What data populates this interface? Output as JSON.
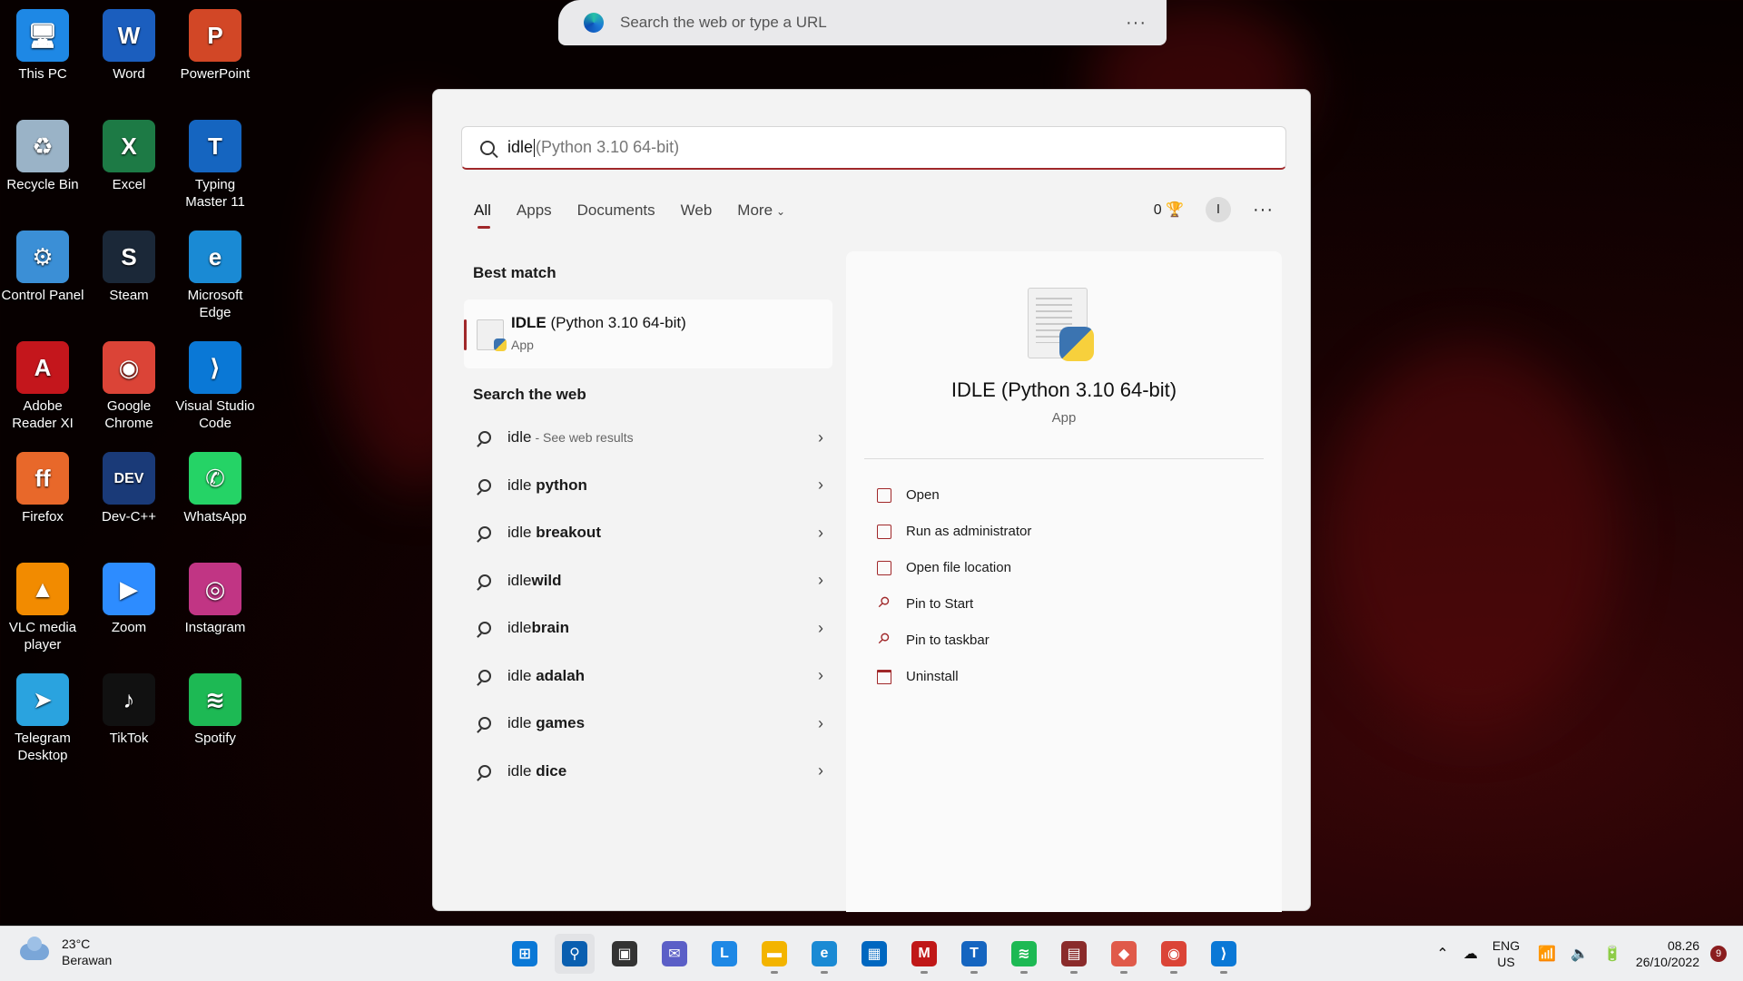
{
  "desktop": {
    "icons": [
      {
        "label": "This PC",
        "glyph": "🖥",
        "color": "#1e88e5"
      },
      {
        "label": "Word",
        "glyph": "W",
        "color": "#1b5ebe"
      },
      {
        "label": "PowerPoint",
        "glyph": "P",
        "color": "#d24726"
      },
      {
        "label": "Recycle Bin",
        "glyph": "♻",
        "color": "#9ab3c7"
      },
      {
        "label": "Excel",
        "glyph": "X",
        "color": "#1d7a45"
      },
      {
        "label": "Typing Master 11",
        "glyph": "T",
        "color": "#1565c0"
      },
      {
        "label": "Control Panel",
        "glyph": "⚙",
        "color": "#3b8fd6"
      },
      {
        "label": "Steam",
        "glyph": "S",
        "color": "#1b2838"
      },
      {
        "label": "Microsoft Edge",
        "glyph": "e",
        "color": "#1a8ad4"
      },
      {
        "label": "Adobe Reader XI",
        "glyph": "A",
        "color": "#c4161c"
      },
      {
        "label": "Google Chrome",
        "glyph": "◉",
        "color": "#db4437"
      },
      {
        "label": "Visual Studio Code",
        "glyph": "⟩",
        "color": "#0a78d6"
      },
      {
        "label": "Firefox",
        "glyph": "ff",
        "color": "#e8682a"
      },
      {
        "label": "Dev-C++",
        "glyph": "DEV",
        "color": "#1a3a78"
      },
      {
        "label": "WhatsApp",
        "glyph": "✆",
        "color": "#25d366"
      },
      {
        "label": "VLC media player",
        "glyph": "▲",
        "color": "#f28b00"
      },
      {
        "label": "Zoom",
        "glyph": "▶",
        "color": "#2d8cff"
      },
      {
        "label": "Instagram",
        "glyph": "◎",
        "color": "#c13584"
      },
      {
        "label": "Telegram Desktop",
        "glyph": "➤",
        "color": "#2aa3df"
      },
      {
        "label": "TikTok",
        "glyph": "♪",
        "color": "#111111"
      },
      {
        "label": "Spotify",
        "glyph": "≋",
        "color": "#1db954"
      }
    ]
  },
  "browser": {
    "placeholder": "Search the web or type a URL",
    "menu": "···"
  },
  "search": {
    "typed": "idle",
    "hint": "(Python 3.10 64-bit)",
    "tabs": [
      "All",
      "Apps",
      "Documents",
      "Web",
      "More"
    ],
    "points": "0",
    "avatar": "I",
    "menu": "···",
    "best_match_title": "Best match",
    "best_match": {
      "name_bold": "IDLE",
      "name_rest": " (Python 3.10 64-bit)",
      "type": "App"
    },
    "web_title": "Search the web",
    "web_results": [
      {
        "q": "idle",
        "bold": "",
        "extra": "- See web results"
      },
      {
        "q": "idle ",
        "bold": "python",
        "extra": ""
      },
      {
        "q": "idle ",
        "bold": "breakout",
        "extra": ""
      },
      {
        "q": "idle",
        "bold": "wild",
        "extra": ""
      },
      {
        "q": "idle",
        "bold": "brain",
        "extra": ""
      },
      {
        "q": "idle ",
        "bold": "adalah",
        "extra": ""
      },
      {
        "q": "idle ",
        "bold": "games",
        "extra": ""
      },
      {
        "q": "idle ",
        "bold": "dice",
        "extra": ""
      }
    ],
    "detail": {
      "name": "IDLE (Python 3.10 64-bit)",
      "type": "App",
      "actions": [
        {
          "label": "Open",
          "icon": "open-icon"
        },
        {
          "label": "Run as administrator",
          "icon": "shield-admin-icon"
        },
        {
          "label": "Open file location",
          "icon": "folder-icon"
        },
        {
          "label": "Pin to Start",
          "icon": "pin-icon"
        },
        {
          "label": "Pin to taskbar",
          "icon": "pin-icon"
        },
        {
          "label": "Uninstall",
          "icon": "trash-icon"
        }
      ]
    }
  },
  "taskbar": {
    "weather_temp": "23°C",
    "weather_desc": "Berawan",
    "apps": [
      {
        "name": "start",
        "glyph": "⊞",
        "color": "#0a78d6"
      },
      {
        "name": "search",
        "glyph": "⚲",
        "color": "#0a5fb0"
      },
      {
        "name": "task-view",
        "glyph": "▣",
        "color": "#333333"
      },
      {
        "name": "chat",
        "glyph": "✉",
        "color": "#5b5fc7"
      },
      {
        "name": "l-app",
        "glyph": "L",
        "color": "#1e88e5"
      },
      {
        "name": "file-explorer",
        "glyph": "▬",
        "color": "#f3b400"
      },
      {
        "name": "edge",
        "glyph": "e",
        "color": "#1a8ad4"
      },
      {
        "name": "store",
        "glyph": "▦",
        "color": "#0067c0"
      },
      {
        "name": "mcafee",
        "glyph": "M",
        "color": "#c01818"
      },
      {
        "name": "typing-master",
        "glyph": "T",
        "color": "#1565c0"
      },
      {
        "name": "spotify",
        "glyph": "≋",
        "color": "#1db954"
      },
      {
        "name": "presenter",
        "glyph": "▤",
        "color": "#8a2b2b"
      },
      {
        "name": "git",
        "glyph": "◆",
        "color": "#e05a4a"
      },
      {
        "name": "chrome",
        "glyph": "◉",
        "color": "#db4437"
      },
      {
        "name": "vscode",
        "glyph": "⟩",
        "color": "#0a78d6"
      }
    ],
    "lang1": "ENG",
    "lang2": "US",
    "time": "08.26",
    "date": "26/10/2022",
    "notifications": "9"
  }
}
